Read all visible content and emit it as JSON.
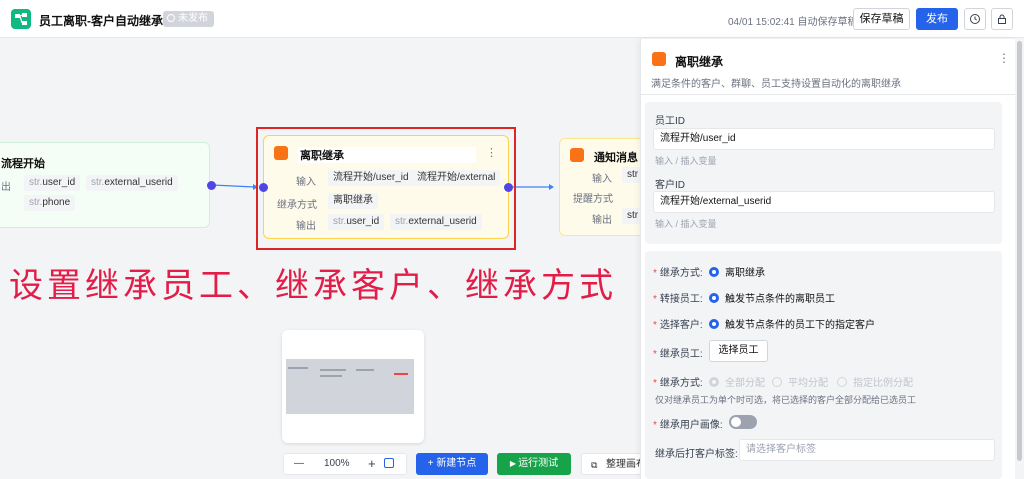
{
  "header": {
    "title": "员工离职-客户自动继承",
    "status": "未发布",
    "autosave": "04/01 15:02:41 自动保存草稿",
    "save_draft": "保存草稿",
    "publish": "发布"
  },
  "canvas": {
    "start_node": {
      "title": "流程开始",
      "output_label": "出",
      "tags": [
        {
          "prefix": "str.",
          "name": "user_id"
        },
        {
          "prefix": "str.",
          "name": "external_userid"
        },
        {
          "prefix": "str.",
          "name": "phone"
        }
      ]
    },
    "main_node": {
      "title": "离职继承",
      "input_label": "输入",
      "inputs": [
        "流程开始/user_id",
        "流程开始/external"
      ],
      "method_label": "继承方式",
      "method_value": "离职继承",
      "output_label": "输出",
      "outputs": [
        {
          "prefix": "str.",
          "name": "user_id"
        },
        {
          "prefix": "str.",
          "name": "external_userid"
        }
      ]
    },
    "notify_node": {
      "title": "通知消息",
      "input_label": "输入",
      "input_value": "str",
      "remind_label": "提醒方式",
      "output_label": "输出",
      "output_value": "str"
    },
    "overlay_text": "设置继承员工、继承客户、继承方式"
  },
  "toolbar": {
    "zoom_minus": "—",
    "zoom_level": "100%",
    "zoom_plus": "+",
    "new_node": "新建节点",
    "run_test": "运行测试",
    "tidy_canvas": "整理画布"
  },
  "panel": {
    "title": "离职继承",
    "description": "满足条件的客户、群聊、员工支持设置自动化的离职继承",
    "employee_id_label": "员工ID",
    "employee_id_value": "流程开始/user_id",
    "employee_id_hint": "输入 / 插入变量",
    "customer_id_label": "客户ID",
    "customer_id_value": "流程开始/external_userid",
    "customer_id_hint": "输入 / 插入变量",
    "inherit_method_label": "继承方式:",
    "inherit_method_option": "离职继承",
    "transfer_employee_label": "转接员工:",
    "transfer_employee_option": "触发节点条件的离职员工",
    "select_customer_label": "选择客户:",
    "select_customer_option": "触发节点条件的员工下的指定客户",
    "inherit_employee_label": "继承员工:",
    "select_employee_button": "选择员工",
    "assign_method_label": "继承方式:",
    "assign_options": [
      "全部分配",
      "平均分配",
      "指定比例分配"
    ],
    "assign_hint": "仅对继承员工为单个时可选，将已选择的客户全部分配给已选员工",
    "inherit_portrait_label": "继承用户画像:",
    "tag_label": "继承后打客户标签:",
    "tag_placeholder": "请选择客户标签"
  },
  "icons": [
    "flow-logo-icon",
    "history-icon",
    "lock-icon",
    "more-icon",
    "plus-icon",
    "play-icon",
    "tidy-icon",
    "fit-view-icon"
  ],
  "colors": {
    "primary": "#2563eb",
    "success": "#16a34a",
    "node_accent": "#f97316",
    "highlight": "#dc2626",
    "logo": "#10b981"
  }
}
